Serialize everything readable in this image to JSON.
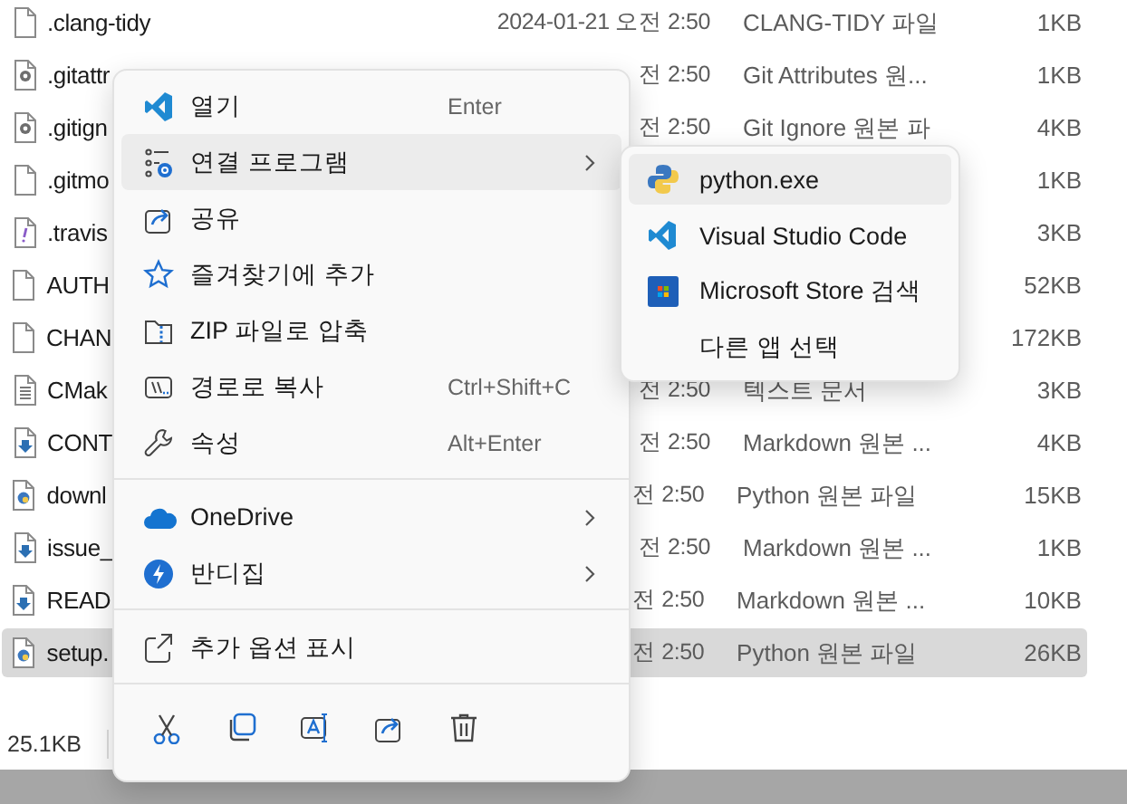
{
  "files": [
    {
      "name": ".clang-tidy",
      "date": "2024-01-21 오전 2:50",
      "type": "CLANG-TIDY 파일",
      "size": "1KB",
      "kind": "plain",
      "selected": false
    },
    {
      "name": ".gitattr",
      "date": "전 2:50",
      "type": "Git Attributes 원...",
      "size": "1KB",
      "kind": "config",
      "selected": false
    },
    {
      "name": ".gitign",
      "date": "전 2:50",
      "type": "Git Ignore 원본 파",
      "size": "4KB",
      "kind": "config",
      "selected": false
    },
    {
      "name": ".gitmo",
      "size": "1KB",
      "kind": "plain",
      "selected": false
    },
    {
      "name": ".travis",
      "size": "3KB",
      "kind": "yaml",
      "selected": false
    },
    {
      "name": "AUTH",
      "size": "52KB",
      "kind": "plain",
      "selected": false
    },
    {
      "name": "CHAN",
      "size": "172KB",
      "kind": "plain",
      "selected": false
    },
    {
      "name": "CMak",
      "date": "전 2:50",
      "type": "텍스트 문서",
      "size": "3KB",
      "kind": "text",
      "selected": false
    },
    {
      "name": "CONT",
      "date": "전 2:50",
      "type": "Markdown 원본 ...",
      "size": "4KB",
      "kind": "markdown",
      "selected": false
    },
    {
      "name": "downl",
      "date": "전 2:50",
      "type": "Python 원본 파일",
      "size": "15KB",
      "kind": "python",
      "selected": false
    },
    {
      "name": "issue_",
      "date": "전 2:50",
      "type": "Markdown 원본 ...",
      "size": "1KB",
      "kind": "markdown",
      "selected": false
    },
    {
      "name": "READ",
      "date": "전 2:50",
      "type": "Markdown 원본 ...",
      "size": "10KB",
      "kind": "markdown",
      "selected": false
    },
    {
      "name": "setup.",
      "date": "전 2:50",
      "type": "Python 원본 파일",
      "size": "26KB",
      "kind": "python",
      "selected": true
    }
  ],
  "status_bar": {
    "selection_size": "25.1KB"
  },
  "context_menu": {
    "items": [
      {
        "kind": "item",
        "label": "열기",
        "shortcut": "Enter",
        "submenu": false,
        "selected": false
      },
      {
        "kind": "item",
        "label": "연결 프로그램",
        "submenu": true,
        "selected": true
      },
      {
        "kind": "item",
        "label": "공유",
        "submenu": false,
        "selected": false
      },
      {
        "kind": "item",
        "label": "즐겨찾기에 추가",
        "submenu": false,
        "selected": false
      },
      {
        "kind": "item",
        "label": "ZIP 파일로 압축",
        "submenu": false,
        "selected": false
      },
      {
        "kind": "item",
        "label": "경로로 복사",
        "shortcut": "Ctrl+Shift+C",
        "submenu": false,
        "selected": false
      },
      {
        "kind": "item",
        "label": "속성",
        "shortcut": "Alt+Enter",
        "submenu": false,
        "selected": false
      },
      {
        "kind": "separator"
      },
      {
        "kind": "item",
        "label": "OneDrive",
        "submenu": true,
        "selected": false
      },
      {
        "kind": "item",
        "label": "반디집",
        "submenu": true,
        "selected": false
      },
      {
        "kind": "separator"
      },
      {
        "kind": "item",
        "label": "추가 옵션 표시",
        "submenu": false,
        "selected": false
      },
      {
        "kind": "separator"
      },
      {
        "kind": "actions"
      }
    ]
  },
  "submenu": {
    "items": [
      {
        "label": "python.exe",
        "selected": true
      },
      {
        "label": "Visual Studio Code",
        "selected": false
      },
      {
        "label": "Microsoft Store 검색",
        "selected": false
      },
      {
        "label": "다른 앱 선택",
        "selected": false
      }
    ]
  }
}
